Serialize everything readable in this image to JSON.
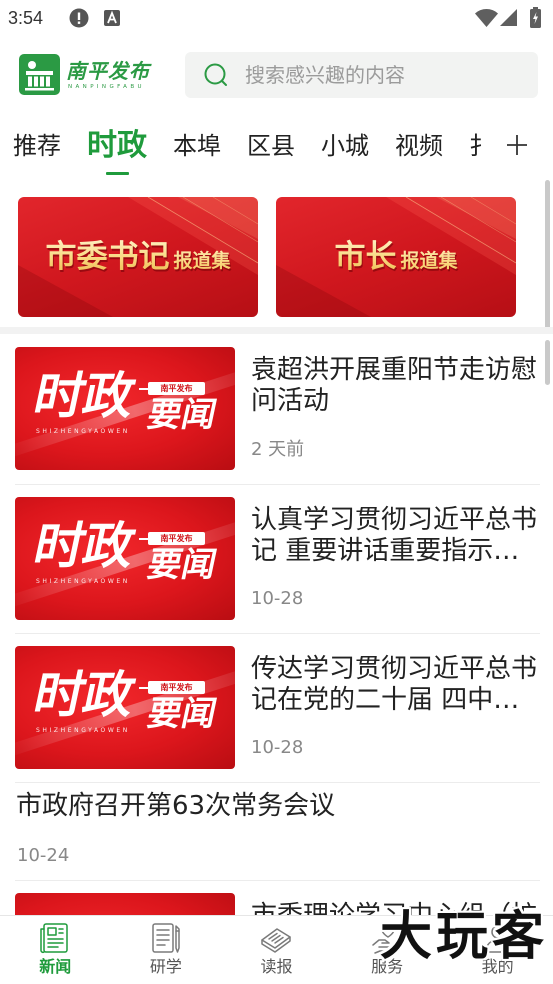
{
  "status_bar": {
    "time": "3:54",
    "left_icons": [
      "alert-icon",
      "a-notification-icon"
    ],
    "right_icons": [
      "wifi-icon",
      "signal-icon",
      "battery-charging-icon"
    ]
  },
  "header": {
    "logo_icon": "nanping-logo-icon",
    "logo_title": "南平发布",
    "logo_subtitle": "NANPINGFABU",
    "search": {
      "icon": "search-icon",
      "placeholder": "搜索感兴趣的内容",
      "value": ""
    }
  },
  "tabs": {
    "items": [
      {
        "label": "推荐",
        "active": false
      },
      {
        "label": "时政",
        "active": true
      },
      {
        "label": "本埠",
        "active": false
      },
      {
        "label": "区县",
        "active": false
      },
      {
        "label": "小城",
        "active": false
      },
      {
        "label": "视频",
        "active": false
      },
      {
        "label": "扌",
        "active": false
      }
    ],
    "add_icon": "plus-icon"
  },
  "banners": [
    {
      "title": "市委书记",
      "suffix": "报道集"
    },
    {
      "title": "市长",
      "suffix": "报道集"
    }
  ],
  "thumbnail": {
    "main": "时政",
    "badge": "南平发布",
    "sub": "要闻",
    "pinyin": "SHIZHENGYAOWEN"
  },
  "news": [
    {
      "title": "袁超洪开展重阳节走访慰问活动",
      "meta": "2 天前"
    },
    {
      "title": "认真学习贯彻习近平总书记 重要讲话重要指示…",
      "meta": "10-28"
    },
    {
      "title": "传达学习贯彻习近平总书记在党的二十届 四中…",
      "meta": "10-28"
    },
    {
      "title": "市政府召开第63次常务会议",
      "meta": "10-24"
    },
    {
      "title": "市委理论学习中心组（扩"
    }
  ],
  "bottom_nav": [
    {
      "label": "新闻",
      "icon": "news-icon",
      "active": true
    },
    {
      "label": "研学",
      "icon": "study-icon",
      "active": false
    },
    {
      "label": "读报",
      "icon": "newspaper-icon",
      "active": false
    },
    {
      "label": "服务",
      "icon": "service-icon",
      "active": false
    },
    {
      "label": "我的",
      "icon": "profile-icon",
      "active": false
    }
  ],
  "watermark": "大玩客",
  "colors": {
    "accent": "#1f9b3c",
    "banner_red": "#d0171e",
    "banner_gold": "#f9d77c",
    "title_text": "#222222",
    "meta_text": "#888888",
    "inactive_nav": "#7a7a7a"
  }
}
